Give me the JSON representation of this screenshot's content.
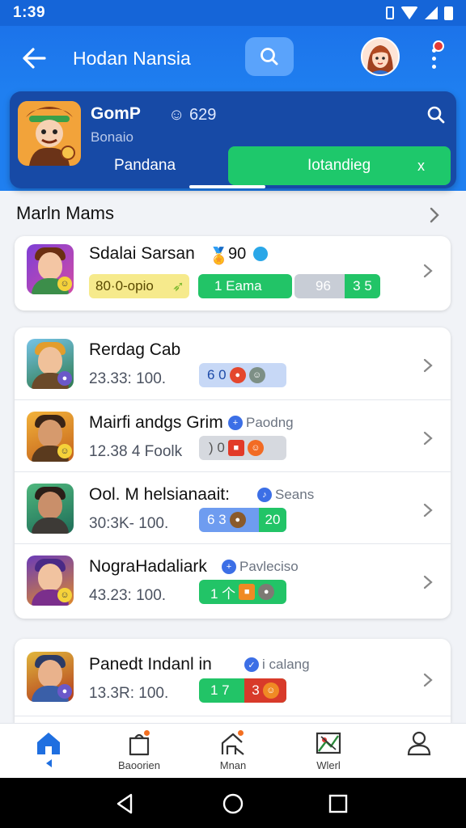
{
  "status_bar": {
    "time": "1:39"
  },
  "app_bar": {
    "title": "Hodan Nansia"
  },
  "game_card": {
    "name": "GomP",
    "score": "☺ 629",
    "subtitle": "Bonaio",
    "tab_left_label": "Pandana",
    "tab_right_label": "Iotandieg",
    "tab_right_close": "x"
  },
  "section": {
    "title": "Marln Mams"
  },
  "featured": {
    "title": "Sdalai Sarsan",
    "title_suffix": "90",
    "pill_yellow": "80·0-opio",
    "pill_green": "1  Eama",
    "pill_gray": "96",
    "pill_gray_tail": "3 5"
  },
  "list": [
    {
      "title": "Rerdag Cab",
      "tag": "",
      "meta": "23.33: 100.",
      "pill": "6  0"
    },
    {
      "title": "Mairfi andgs Grim",
      "tag": "Paodng",
      "meta": "12.38 4 Foolk",
      "pill": ")  0"
    },
    {
      "title": "Ool. M helsianaait:",
      "tag": "Seans",
      "meta": "30:3K- 100.",
      "pill": "6  3",
      "pill_tail": "20"
    },
    {
      "title": "NograHadaliark",
      "tag": "Pavleciso",
      "meta": "43.23: 100.",
      "pill": "1  个"
    }
  ],
  "last_item": {
    "title": "Panedt Indanl in",
    "tag": "i calang",
    "meta": "13.3R: 100.",
    "pill": "1  7",
    "pill_tail": "3"
  },
  "bottom_nav": [
    "",
    "Baoorien",
    "Mnan",
    "Wlerl",
    ""
  ],
  "colors": {
    "primary": "#1f7ff0",
    "accent_green": "#1ec86b",
    "card_dark": "#174aa6",
    "pill_blue": "#6e9cf0"
  }
}
